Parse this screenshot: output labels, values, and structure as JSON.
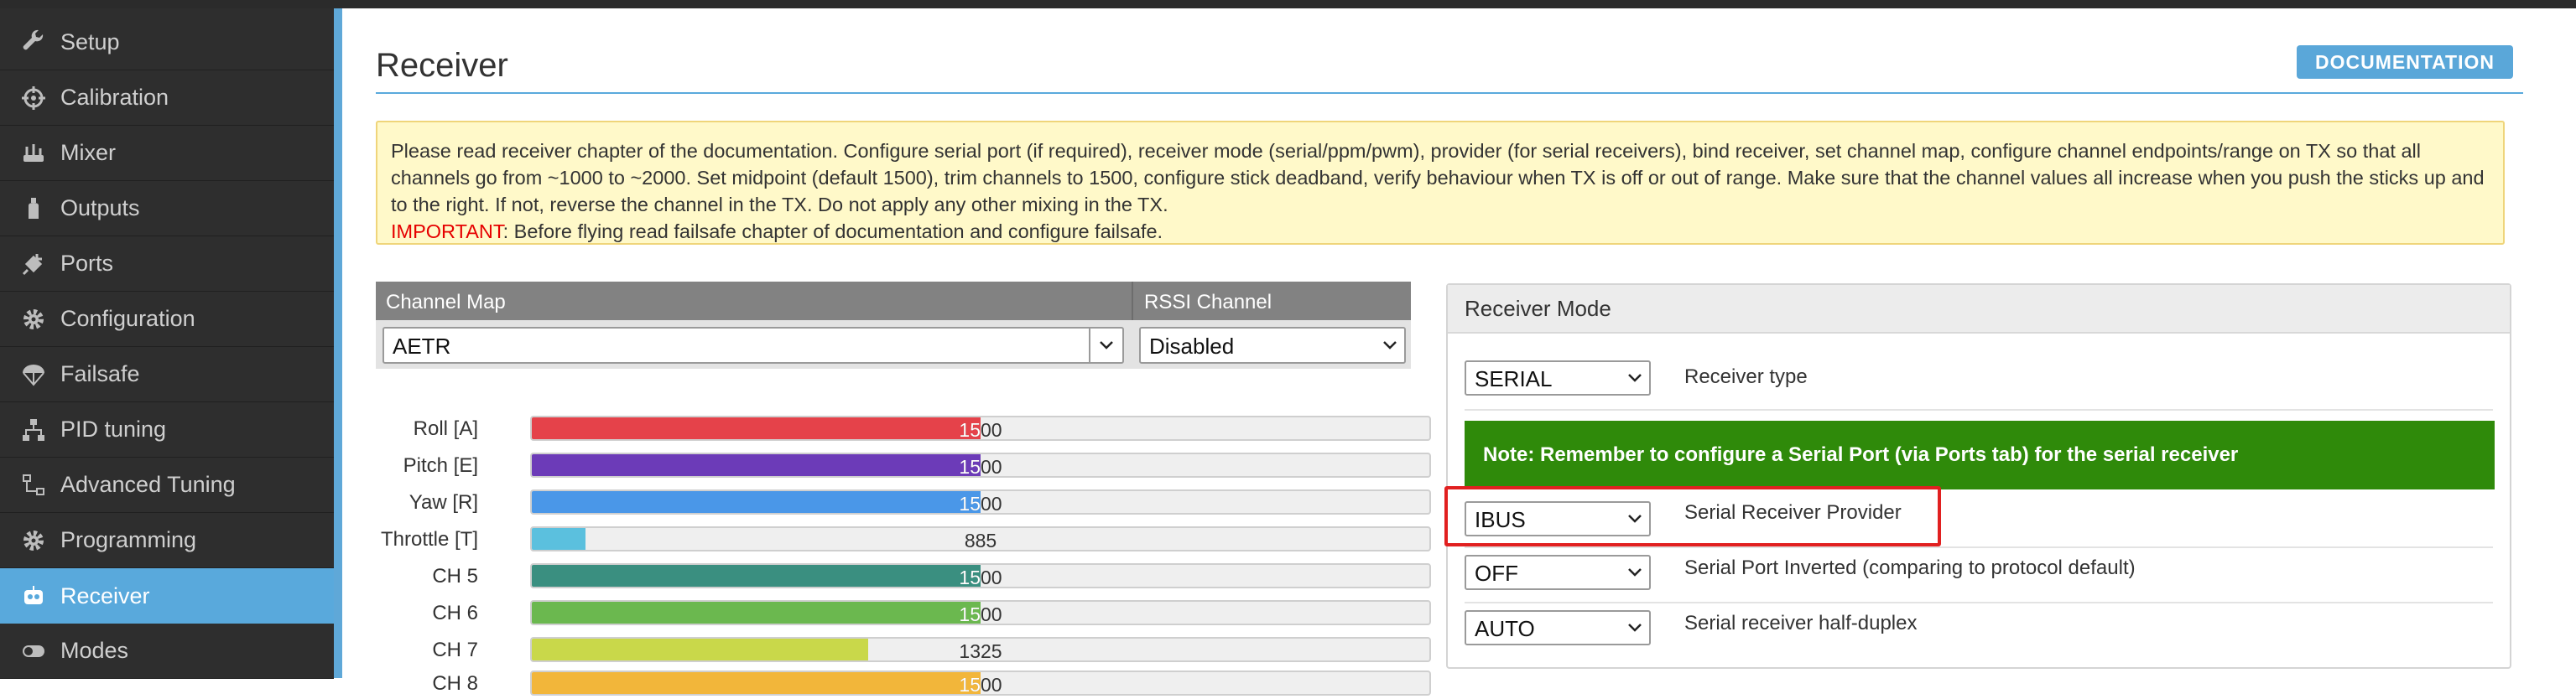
{
  "sidebar": {
    "items": [
      {
        "label": "Setup",
        "icon": "wrench-icon",
        "active": false
      },
      {
        "label": "Calibration",
        "icon": "crosshair-icon",
        "active": false
      },
      {
        "label": "Mixer",
        "icon": "mixer-icon",
        "active": false
      },
      {
        "label": "Outputs",
        "icon": "bottle-icon",
        "active": false
      },
      {
        "label": "Ports",
        "icon": "plug-icon",
        "active": false
      },
      {
        "label": "Configuration",
        "icon": "gear-icon",
        "active": false
      },
      {
        "label": "Failsafe",
        "icon": "parachute-icon",
        "active": false
      },
      {
        "label": "PID tuning",
        "icon": "hierarchy-icon",
        "active": false
      },
      {
        "label": "Advanced Tuning",
        "icon": "flow-icon",
        "active": false
      },
      {
        "label": "Programming",
        "icon": "gear-icon",
        "active": false
      },
      {
        "label": "Receiver",
        "icon": "robot-icon",
        "active": true
      },
      {
        "label": "Modes",
        "icon": "toggle-icon",
        "active": false
      }
    ]
  },
  "header": {
    "title": "Receiver",
    "documentation_label": "DOCUMENTATION"
  },
  "note": {
    "text": "Please read receiver chapter of the documentation. Configure serial port (if required), receiver mode (serial/ppm/pwm), provider (for serial receivers), bind receiver, set channel map, configure channel endpoints/range on TX so that all channels go from ~1000 to ~2000. Set midpoint (default 1500), trim channels to 1500, configure stick deadband, verify behaviour when TX is off or out of range. Make sure that the channel values all increase when you push the sticks up and to the right. If not, reverse the channel in the TX. Do not apply any other mixing in the TX.",
    "important_label": "IMPORTANT",
    "important_text": ": Before flying read failsafe chapter of documentation and configure failsafe."
  },
  "channel_map": {
    "header_label": "Channel Map",
    "value": "AETR",
    "rssi_header_label": "RSSI Channel",
    "rssi_value": "Disabled"
  },
  "channels": [
    {
      "label": "Roll [A]",
      "value": "1500",
      "fill": 0.5,
      "color": "#e5424a"
    },
    {
      "label": "Pitch [E]",
      "value": "1500",
      "fill": 0.5,
      "color": "#6c3bb8"
    },
    {
      "label": "Yaw [R]",
      "value": "1500",
      "fill": 0.5,
      "color": "#4a97e8"
    },
    {
      "label": "Throttle [T]",
      "value": "885",
      "fill": 0.06,
      "color": "#5bc0de"
    },
    {
      "label": "CH 5",
      "value": "1500",
      "fill": 0.5,
      "color": "#3a8f80"
    },
    {
      "label": "CH 6",
      "value": "1500",
      "fill": 0.5,
      "color": "#6bb84f"
    },
    {
      "label": "CH 7",
      "value": "1325",
      "fill": 0.375,
      "color": "#c9d84a"
    },
    {
      "label": "CH 8",
      "value": "1500",
      "fill": 0.5,
      "color": "#f2b63a"
    }
  ],
  "receiver_mode": {
    "title": "Receiver Mode",
    "receiver_type_value": "SERIAL",
    "receiver_type_label": "Receiver type",
    "serial_note": "Note: Remember to configure a Serial Port (via Ports tab) for the serial receiver",
    "provider_value": "IBUS",
    "provider_label": "Serial Receiver Provider",
    "inverted_value": "OFF",
    "inverted_label": "Serial Port Inverted (comparing to protocol default)",
    "halfduplex_value": "AUTO",
    "halfduplex_label": "Serial receiver half-duplex"
  }
}
